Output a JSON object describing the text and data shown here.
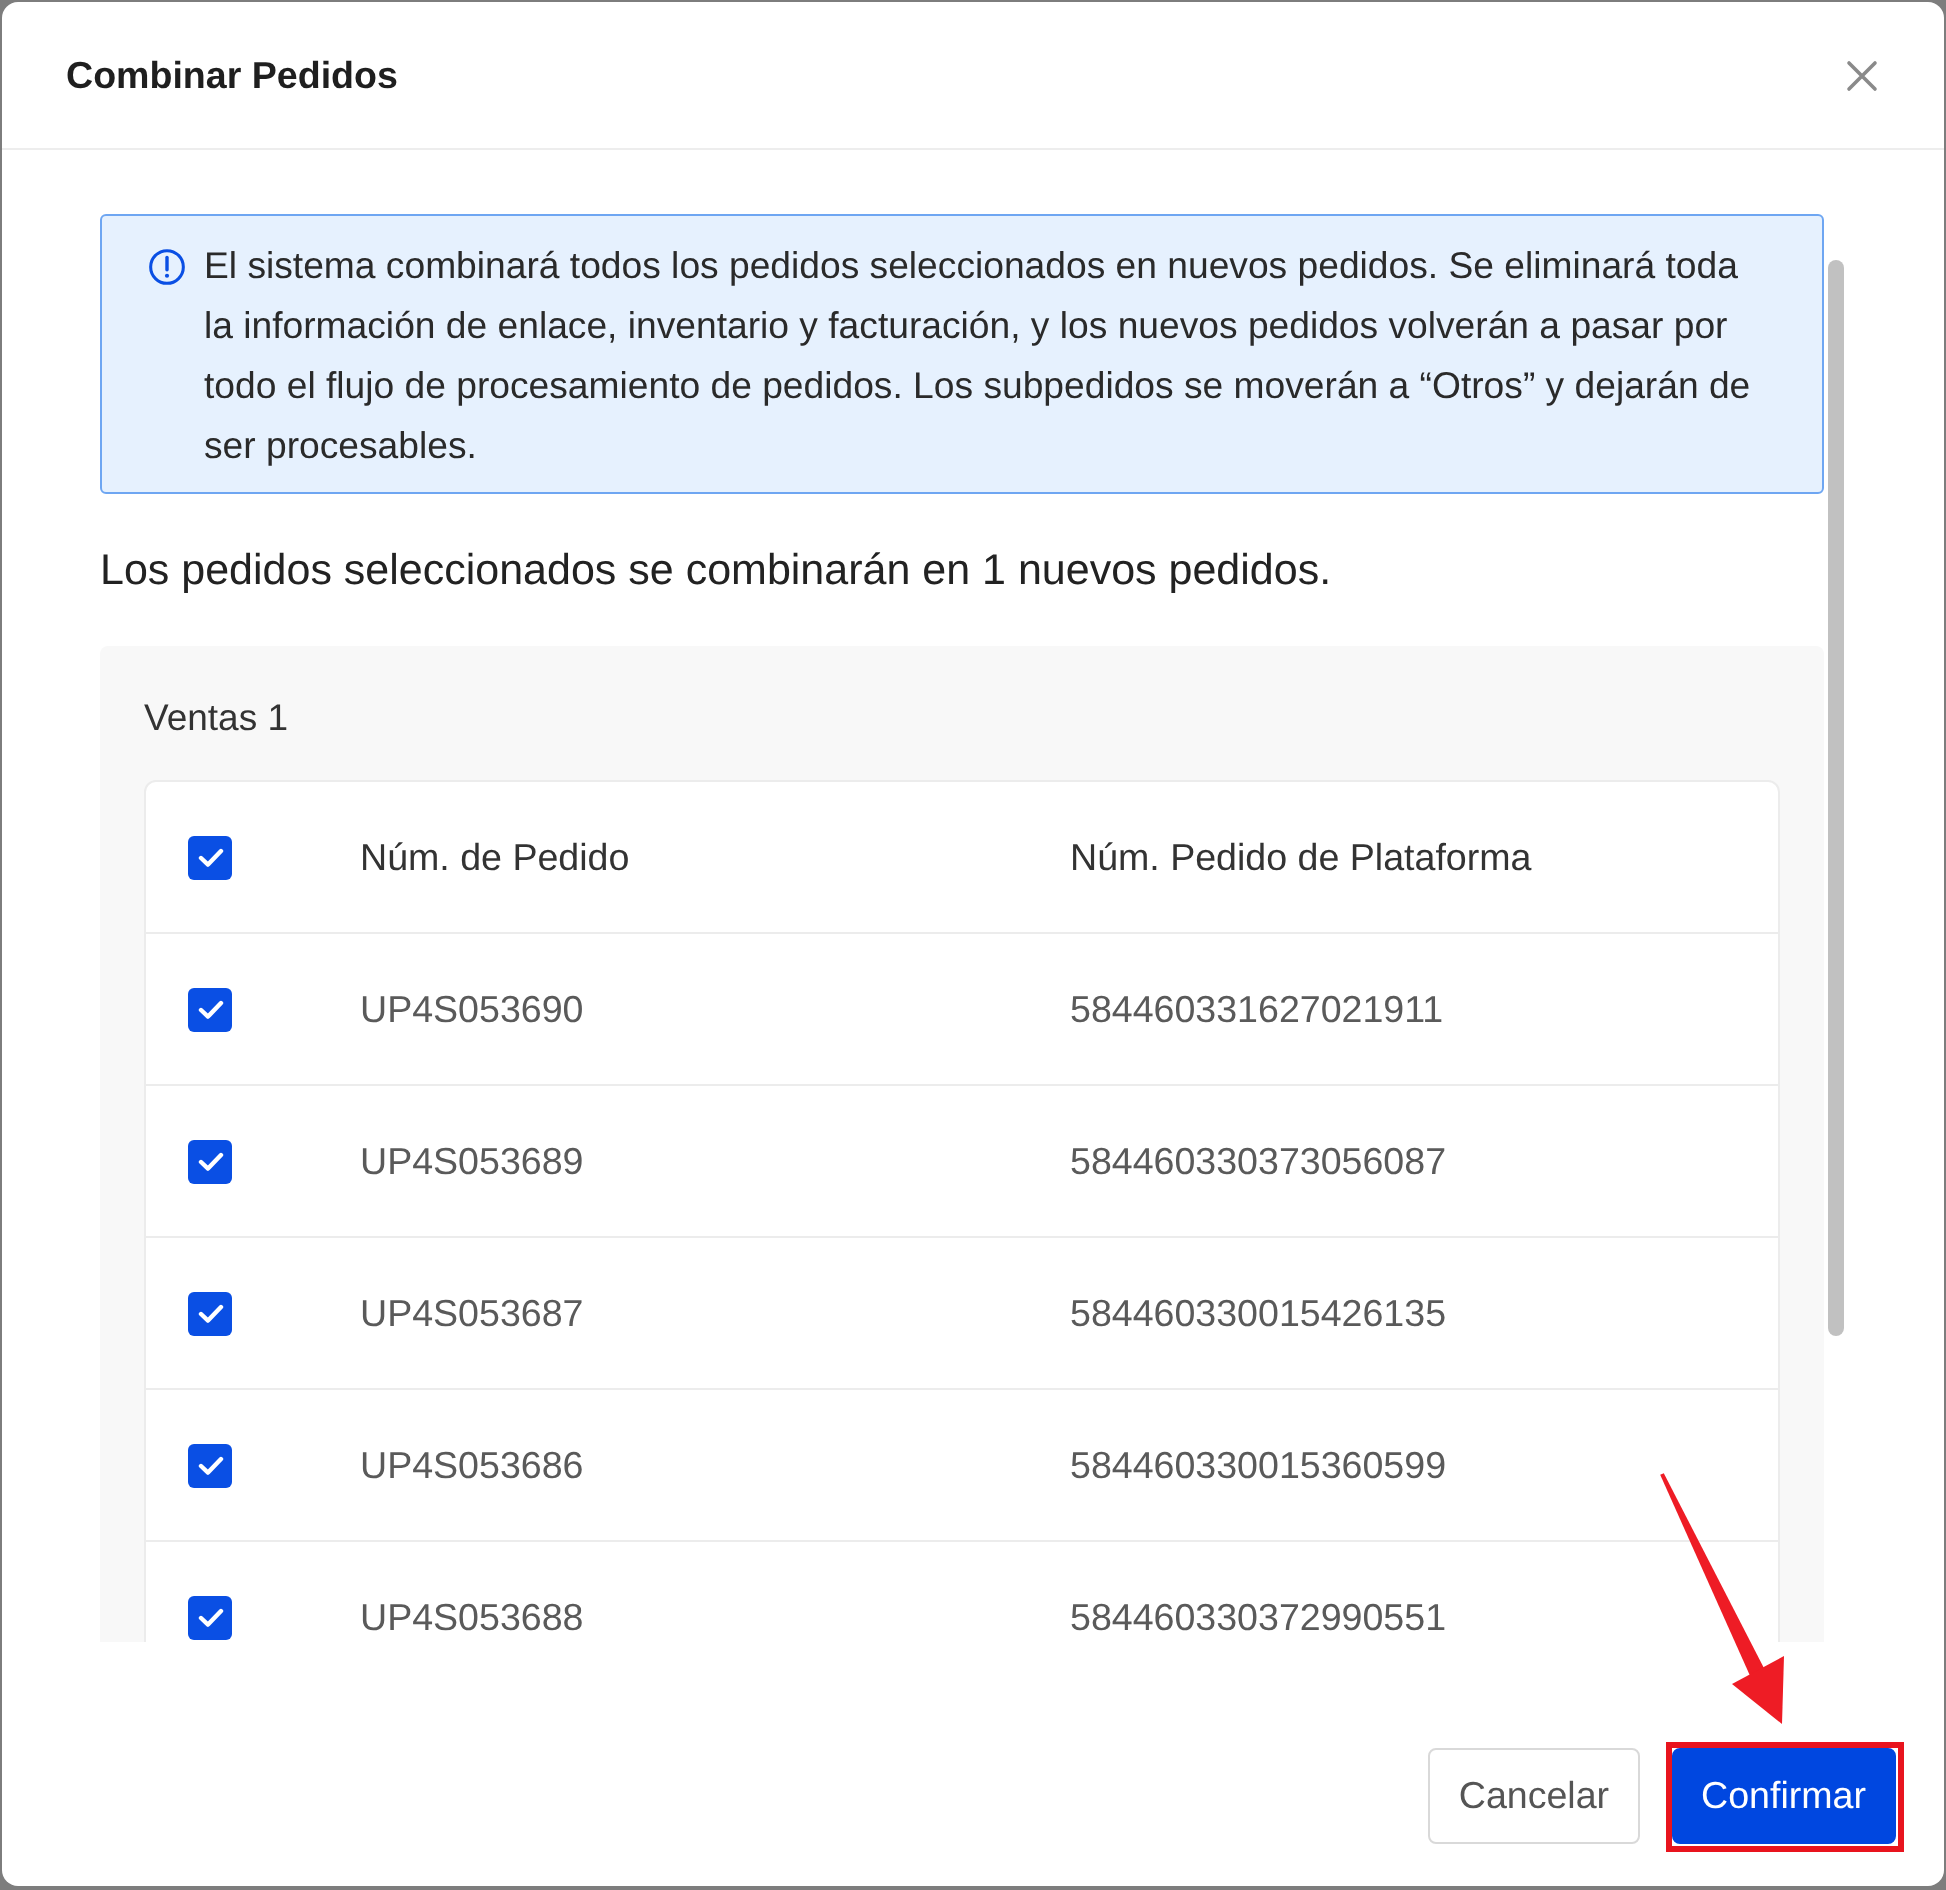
{
  "dialog": {
    "title": "Combinar Pedidos"
  },
  "notice": {
    "text": "El sistema combinará todos los pedidos seleccionados en nuevos pedidos. Se eliminará toda la información de enlace, inventario y facturación, y los nuevos pedidos volverán a pasar por todo el flujo de procesamiento de pedidos. Los subpedidos se moverán a “Otros” y dejarán de ser procesables."
  },
  "summary": "Los pedidos seleccionados se combinarán en 1 nuevos pedidos.",
  "group": {
    "title": "Ventas 1",
    "table": {
      "columns": [
        "Núm. de Pedido",
        "Núm. Pedido de Plataforma"
      ],
      "header_checked": true,
      "rows": [
        {
          "checked": true,
          "cells": [
            "UP4S053690",
            "584460331627021911"
          ]
        },
        {
          "checked": true,
          "cells": [
            "UP4S053689",
            "584460330373056087"
          ]
        },
        {
          "checked": true,
          "cells": [
            "UP4S053687",
            "584460330015426135"
          ]
        },
        {
          "checked": true,
          "cells": [
            "UP4S053686",
            "584460330015360599"
          ]
        },
        {
          "checked": true,
          "cells": [
            "UP4S053688",
            "584460330372990551"
          ]
        }
      ]
    }
  },
  "footer": {
    "buttons": [
      {
        "label": "Cancelar",
        "kind": "secondary",
        "highlighted": false
      },
      {
        "label": "Confirmar",
        "kind": "primary",
        "highlighted": true
      }
    ]
  }
}
